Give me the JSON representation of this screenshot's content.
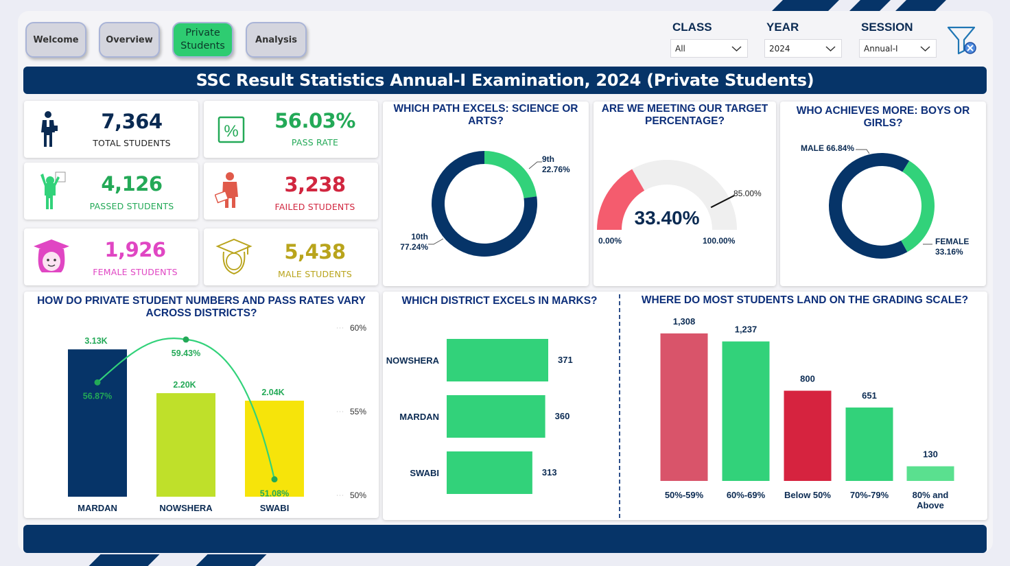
{
  "nav": {
    "buttons": [
      {
        "label": "Welcome",
        "active": false
      },
      {
        "label": "Overview",
        "active": false
      },
      {
        "label": "Private Students",
        "active": true
      },
      {
        "label": "Analysis",
        "active": false
      }
    ]
  },
  "filters": {
    "class": {
      "label": "CLASS",
      "value": "All"
    },
    "year": {
      "label": "YEAR",
      "value": "2024"
    },
    "session": {
      "label": "SESSION",
      "value": "Annual-I"
    }
  },
  "title": "SSC Result Statistics Annual-I Examination, 2024 (Private Students)",
  "kpis": {
    "total": {
      "value": "7,364",
      "label": "TOTAL STUDENTS",
      "color": "#0a2a52"
    },
    "pass_rate": {
      "value": "56.03%",
      "label": "PASS RATE",
      "color": "#23a957"
    },
    "passed": {
      "value": "4,126",
      "label": "PASSED STUDENTS",
      "color": "#23a957"
    },
    "failed": {
      "value": "3,238",
      "label": "FAILED STUDENTS",
      "color": "#d1263f"
    },
    "female": {
      "value": "1,926",
      "label": "FEMALE STUDENTS",
      "color": "#e046c3"
    },
    "male": {
      "value": "5,438",
      "label": "MALE STUDENTS",
      "color": "#b9a41c"
    }
  },
  "colors": {
    "navy": "#063468",
    "green": "#32d27a",
    "lime": "#bfe02a",
    "yellow": "#f6e40a",
    "red": "#d6233f",
    "pink_red": "#d9546a",
    "gauge_red": "#f45c6e",
    "gauge_bg": "#efefef"
  },
  "science_arts": {
    "title": "WHICH PATH EXCELS: SCIENCE OR ARTS?",
    "slices": [
      {
        "name": "9th",
        "value": 22.76,
        "label": "22.76%"
      },
      {
        "name": "10th",
        "value": 77.24,
        "label": "77.24%"
      }
    ]
  },
  "target": {
    "title": "ARE WE MEETING OUR TARGET PERCENTAGE?",
    "value": 33.4,
    "value_label": "33.40%",
    "target": 85.0,
    "target_label": "85.00%",
    "min_label": "0.00%",
    "max_label": "100.00%"
  },
  "gender": {
    "title": "WHO ACHIEVES MORE: BOYS OR GIRLS?",
    "slices": [
      {
        "name": "MALE",
        "value": 66.84,
        "label": "66.84%"
      },
      {
        "name": "FEMALE",
        "value": 33.16,
        "label": "33.16%"
      }
    ]
  },
  "chart_data": [
    {
      "type": "bar",
      "title": "HOW DO PRIVATE STUDENT NUMBERS AND PASS RATES VARY ACROSS DISTRICTS?",
      "categories": [
        "MARDAN",
        "NOWSHERA",
        "SWABI"
      ],
      "series": [
        {
          "values": [
            3130,
            2200,
            2040
          ],
          "labels": [
            "3.13K",
            "2.20K",
            "2.04K"
          ]
        },
        {
          "type": "line",
          "values": [
            56.87,
            59.43,
            51.08
          ],
          "labels": [
            "56.87%",
            "59.43%",
            "51.08%"
          ]
        }
      ],
      "bar_ylim": [
        0,
        3600
      ],
      "y2_ticks": [
        "60%",
        "55%",
        "50%"
      ],
      "y2lim": [
        50,
        60
      ]
    },
    {
      "type": "bar",
      "orientation": "horizontal",
      "title": "WHICH DISTRICT EXCELS IN MARKS?",
      "categories": [
        "NOWSHERA",
        "MARDAN",
        "SWABI"
      ],
      "values": [
        371,
        360,
        313
      ],
      "labels": [
        "371",
        "360",
        "313"
      ]
    },
    {
      "type": "bar",
      "title": "WHERE DO MOST STUDENTS LAND ON THE GRADING SCALE?",
      "categories": [
        "50%-59%",
        "60%-69%",
        "Below 50%",
        "70%-79%",
        "80% and Above"
      ],
      "values": [
        1308,
        1237,
        800,
        651,
        130
      ],
      "labels": [
        "1,308",
        "1,237",
        "800",
        "651",
        "130"
      ]
    }
  ]
}
